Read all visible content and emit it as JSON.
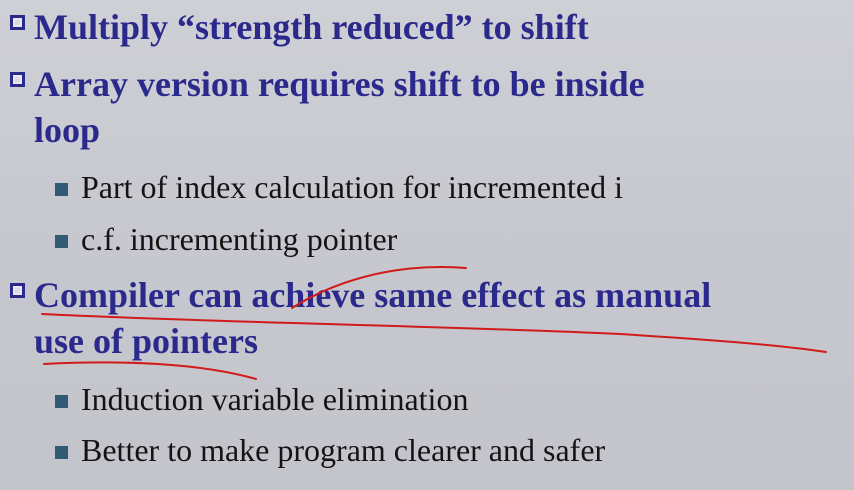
{
  "slide": {
    "items": [
      {
        "level": 1,
        "text": "Multiply “strength reduced” to shift"
      },
      {
        "level": 1,
        "line1": "Array version requires shift to be inside",
        "line2": "loop"
      },
      {
        "level": 2,
        "text": "Part of index calculation for incremented i"
      },
      {
        "level": 2,
        "text": "c.f. incrementing pointer"
      },
      {
        "level": 1,
        "line1": "Compiler can achieve same effect as manual",
        "line2": "use of pointers"
      },
      {
        "level": 2,
        "text": "Induction variable elimination"
      },
      {
        "level": 2,
        "text": "Better to make program clearer and safer"
      }
    ]
  },
  "colors": {
    "heading": "#2b2a8c",
    "body_text": "#141414",
    "sub_bullet": "#2f5c74",
    "annotation": "#d11b1b",
    "background": "#c9c9d1"
  }
}
